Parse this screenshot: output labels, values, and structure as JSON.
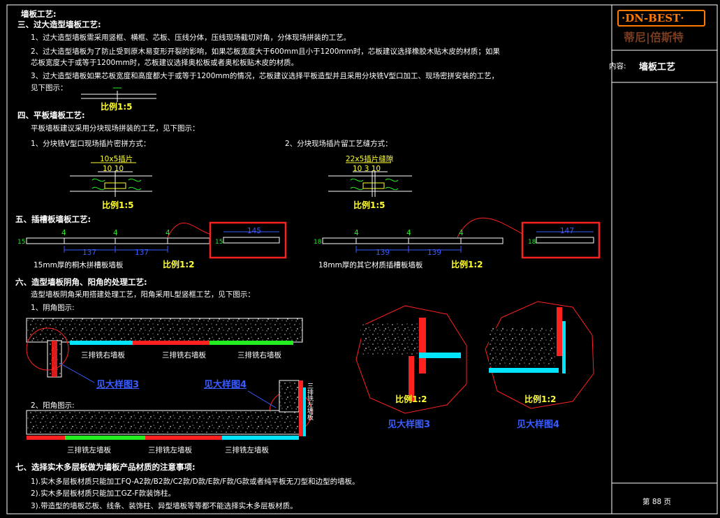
{
  "title_block": {
    "logo_text": "·DN-BEST·",
    "logo_sub": "蒂尼|倍斯特",
    "content_label": "内容:",
    "content_value": "墙板工艺",
    "page_label": "第 88 页"
  },
  "doc": {
    "heading": "墙板工艺:",
    "s3_title": "三、过大造型墙板工艺:",
    "s3_l1": "1、过大造型墙板需采用竖框、横框、芯板、压线分体，压线现场截切对角，分体现场拼装的工艺。",
    "s3_l2": "2、过大造型墙板为了防止受到原木易变形开裂的影响，如果芯板宽度大于600mm且小于1200mm时，芯板建议选择橡胶木贴木皮的材质；如果",
    "s3_l3": "芯板宽度大于或等于1200mm时，芯板建议选择奥松板或者奥松板贴木皮的材质。",
    "s3_l4": "3、过大造型墙板如果芯板宽度和高度都大于或等于1200mm的情况，芯板建议选择平板造型并且采用分块铣V型口加工、现场密拼安装的工艺，",
    "s3_l5": "见下图示：",
    "s3_scale": "比例1:5",
    "s4_title": "四、平板墙板工艺:",
    "s4_l1": "平板墙板建议采用分块现场拼装的工艺，见下图示：",
    "s4_fig1": "1、分块铣V型口现场插片密拼方式：",
    "s4_fig2": "2、分块现场插片留工艺缝方式：",
    "s4_scale1": "比例1:5",
    "s4_scale2": "比例1:5",
    "s4_label1": "10x5插片",
    "s4_label2": "22x5插片缝隙",
    "s4_dim1": "10  10",
    "s4_dim2": "10 3 10",
    "s5_title": "五、插槽板墙板工艺:",
    "s5_cap1": "15mm厚的桐木拼槽板墙板",
    "s5_cap2": "18mm厚的其它材质插槽板墙板",
    "s5_scale1": "比例1:2",
    "s5_scale2": "比例1:2",
    "s5_d145": "145",
    "s5_d147": "147",
    "s5_d137a": "137",
    "s5_d137b": "137",
    "s5_d139a": "139",
    "s5_d139b": "139",
    "s5_d15a": "15",
    "s5_d15b": "15",
    "s5_d18a": "18",
    "s5_d18b": "18",
    "s5_d4": "4",
    "s6_title": "六、造型墙板阴角、阳角的处理工艺:",
    "s6_l1": "造型墙板阴角采用搭建处理工艺，阳角采用L型竖框工艺，见下图示：",
    "s6_fig1": "1、阴角图示:",
    "s6_fig2": "2、阳角图示:",
    "s6_lbl_r1": "三排铣右墙板",
    "s6_lbl_r2": "三排铣右墙板",
    "s6_lbl_r3": "三排铣右墙板",
    "s6_lbl_l1": "三排铣左墙板",
    "s6_lbl_l2": "三排铣左墙板",
    "s6_lbl_l3": "三排铣左墙板",
    "s6_vert": "三排铣左墙板",
    "s6_see3": "见大样图3",
    "s6_see4": "见大样图4",
    "s6_scale3": "比例1:2",
    "s6_scale4": "比例1:2",
    "s6_detail3": "见大样图3",
    "s6_detail4": "见大样图4",
    "s7_title": "七、选择实木多层板做为墙板产品材质的注意事项:",
    "s7_l1": "1).实木多层板材质只能加工FQ-A2款/B2款/C2款/D款/E款/F款/G款或者纯平板无刀型和边型的墙板。",
    "s7_l2": "2).实木多层板材质只能加工GZ-F款装饰柱。",
    "s7_l3": "3).带造型的墙板芯板、线条、装饰柱、异型墙板等等都不能选择实木多层板材质。"
  },
  "colors": {
    "frame": "#ffffff",
    "red": "#ff2020",
    "cyan": "#00e5ff",
    "green": "#22ee22",
    "yellow": "#ffff33",
    "blue": "#3a5cff",
    "logo_orange": "#ff7a00"
  }
}
